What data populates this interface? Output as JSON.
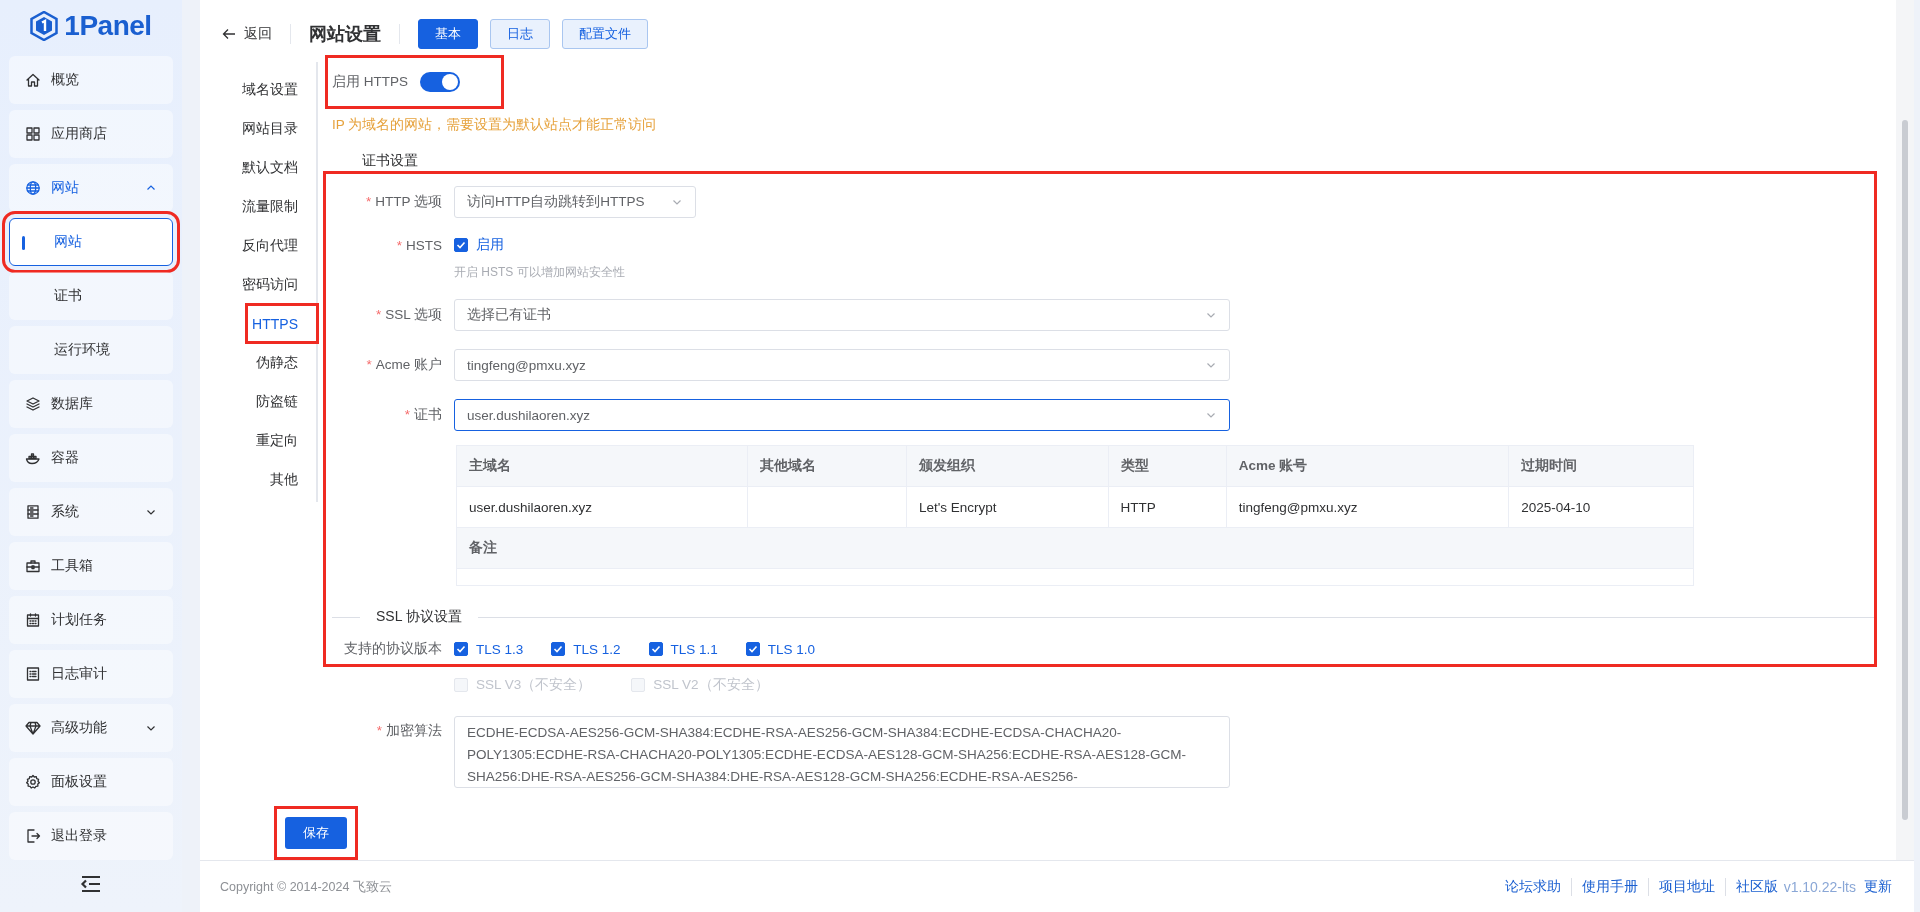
{
  "sidebar": {
    "logo": "1Panel",
    "items": [
      {
        "label": "概览",
        "selected": false
      },
      {
        "label": "应用商店",
        "selected": false
      },
      {
        "label": "网站",
        "selected": true,
        "expanded": true,
        "children": [
          {
            "label": "网站",
            "selected": true,
            "highlighted": true
          },
          {
            "label": "证书",
            "selected": false,
            "highlighted": false
          },
          {
            "label": "运行环境",
            "selected": false,
            "highlighted": false
          }
        ]
      },
      {
        "label": "数据库",
        "selected": false
      },
      {
        "label": "容器",
        "selected": false
      },
      {
        "label": "系统",
        "selected": false,
        "expanded": false
      },
      {
        "label": "工具箱",
        "selected": false
      },
      {
        "label": "计划任务",
        "selected": false
      },
      {
        "label": "日志审计",
        "selected": false
      },
      {
        "label": "高级功能",
        "selected": false,
        "expanded": false
      },
      {
        "label": "面板设置",
        "selected": false
      },
      {
        "label": "退出登录",
        "selected": false
      }
    ]
  },
  "header": {
    "back": "返回",
    "title": "网站设置",
    "tabs": [
      {
        "label": "基本",
        "selected": true
      },
      {
        "label": "日志",
        "selected": false
      },
      {
        "label": "配置文件",
        "selected": false
      }
    ]
  },
  "subnav": [
    {
      "label": "域名设置",
      "selected": false,
      "highlighted": false
    },
    {
      "label": "网站目录",
      "selected": false,
      "highlighted": false
    },
    {
      "label": "默认文档",
      "selected": false,
      "highlighted": false
    },
    {
      "label": "流量限制",
      "selected": false,
      "highlighted": false
    },
    {
      "label": "反向代理",
      "selected": false,
      "highlighted": false
    },
    {
      "label": "密码访问",
      "selected": false,
      "highlighted": false
    },
    {
      "label": "HTTPS",
      "selected": true,
      "highlighted": true
    },
    {
      "label": "伪静态",
      "selected": false,
      "highlighted": false
    },
    {
      "label": "防盗链",
      "selected": false,
      "highlighted": false
    },
    {
      "label": "重定向",
      "selected": false,
      "highlighted": false
    },
    {
      "label": "其他",
      "selected": false,
      "highlighted": false
    }
  ],
  "https": {
    "label": "启用 HTTPS",
    "on": true,
    "highlighted": true,
    "warning": "IP 为域名的网站，需要设置为默认站点才能正常访问"
  },
  "cert_section": {
    "title": "证书设置",
    "highlighted": true,
    "fields": [
      {
        "kind": "select",
        "required_mark": "*",
        "label": "HTTP 选项",
        "value": "访问HTTP自动跳转到HTTPS",
        "wide": false,
        "focused": false
      },
      {
        "kind": "checkbox",
        "required_mark": "*",
        "label": "HSTS",
        "option": "启用",
        "checked": true,
        "hint": "开启 HSTS 可以增加网站安全性"
      },
      {
        "kind": "select",
        "required_mark": "*",
        "label": "SSL 选项",
        "value": "选择已有证书",
        "wide": true,
        "focused": false
      },
      {
        "kind": "select",
        "required_mark": "*",
        "label": "Acme 账户",
        "value": "tingfeng@pmxu.xyz",
        "wide": true,
        "focused": false
      },
      {
        "kind": "select",
        "required_mark": "*",
        "label": "证书",
        "value": "user.dushilaoren.xyz",
        "wide": true,
        "focused": true
      }
    ],
    "table": {
      "columns": [
        "主域名",
        "其他域名",
        "颁发组织",
        "类型",
        "Acme 账号",
        "过期时间"
      ],
      "rows": [
        [
          "user.dushilaoren.xyz",
          "",
          "Let's Encrypt",
          "HTTP",
          "tingfeng@pmxu.xyz",
          "2025-04-10"
        ]
      ],
      "note_label": "备注"
    },
    "protocol_title": "SSL 协议设置",
    "protocol_label": "支持的协议版本",
    "protocols": [
      {
        "label": "TLS 1.3",
        "checked": true,
        "disabled": false
      },
      {
        "label": "TLS 1.2",
        "checked": true,
        "disabled": false
      },
      {
        "label": "TLS 1.1",
        "checked": true,
        "disabled": false
      },
      {
        "label": "TLS 1.0",
        "checked": true,
        "disabled": false
      }
    ]
  },
  "legacy_protocols": [
    {
      "label": "SSL V3（不安全）",
      "checked": false,
      "disabled": true
    },
    {
      "label": "SSL V2（不安全）",
      "checked": false,
      "disabled": true
    }
  ],
  "cipher": {
    "required_mark": "*",
    "label": "加密算法",
    "value": "ECDHE-ECDSA-AES256-GCM-SHA384:ECDHE-RSA-AES256-GCM-SHA384:ECDHE-ECDSA-CHACHA20-POLY1305:ECDHE-RSA-CHACHA20-POLY1305:ECDHE-ECDSA-AES128-GCM-SHA256:ECDHE-RSA-AES128-GCM-SHA256:DHE-RSA-AES256-GCM-SHA384:DHE-RSA-AES128-GCM-SHA256:ECDHE-RSA-AES256-"
  },
  "save": {
    "label": "保存",
    "highlighted": true
  },
  "footer": {
    "copyright": "Copyright © 2014-2024 飞致云",
    "links": [
      "论坛求助",
      "使用手册",
      "项目地址"
    ],
    "edition": "社区版",
    "version": "v1.10.22-lts",
    "update": "更新"
  }
}
